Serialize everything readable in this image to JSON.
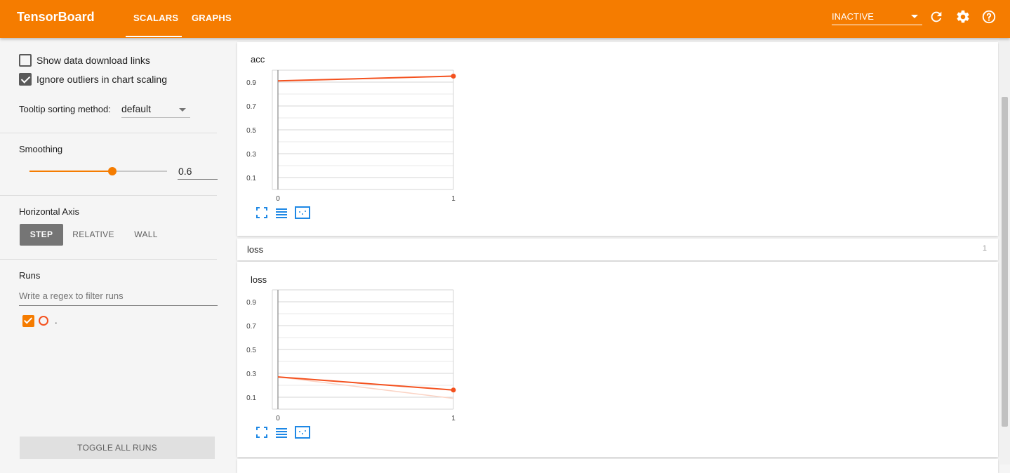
{
  "header": {
    "brand": "TensorBoard",
    "tabs": [
      {
        "label": "SCALARS",
        "active": true
      },
      {
        "label": "GRAPHS",
        "active": false
      }
    ],
    "status_select": "INACTIVE",
    "icons": [
      "reload-icon",
      "settings-icon",
      "help-icon"
    ],
    "accent_color": "#f57c00"
  },
  "sidebar": {
    "show_download_links": {
      "label": "Show data download links",
      "checked": false
    },
    "ignore_outliers": {
      "label": "Ignore outliers in chart scaling",
      "checked": true
    },
    "tooltip_sorting": {
      "label": "Tooltip sorting method:",
      "value": "default"
    },
    "smoothing": {
      "label": "Smoothing",
      "value": "0.6",
      "fraction": 0.6
    },
    "horizontal_axis": {
      "label": "Horizontal Axis",
      "options": [
        "STEP",
        "RELATIVE",
        "WALL"
      ],
      "selected": "STEP"
    },
    "runs": {
      "label": "Runs",
      "filter_placeholder": "Write a regex to filter runs",
      "items": [
        {
          "name": ".",
          "checked": true,
          "color": "#f4511e"
        }
      ]
    },
    "toggle_all_label": "TOGGLE ALL RUNS"
  },
  "main": {
    "acc_card": {
      "title": "acc"
    },
    "loss_group": {
      "label": "loss",
      "count": "1"
    },
    "loss_card": {
      "title": "loss"
    }
  },
  "chart_data": [
    {
      "type": "line",
      "title": "acc",
      "x_ticks": [
        "0",
        "1"
      ],
      "y_ticks": [
        "0.9",
        "0.7",
        "0.5",
        "0.3",
        "0.1"
      ],
      "xlim": [
        0,
        1
      ],
      "ylim": [
        0,
        1
      ],
      "series": [
        {
          "name": ".",
          "smoothed": true,
          "color": "#f4511e",
          "x": [
            0,
            1
          ],
          "y": [
            0.91,
            0.95
          ]
        }
      ],
      "grid": true
    },
    {
      "type": "line",
      "title": "loss",
      "x_ticks": [
        "0",
        "1"
      ],
      "y_ticks": [
        "0.9",
        "0.7",
        "0.5",
        "0.3",
        "0.1"
      ],
      "xlim": [
        0,
        1
      ],
      "ylim": [
        0,
        1
      ],
      "series": [
        {
          "name": ".",
          "smoothed": true,
          "color": "#f4511e",
          "x": [
            0,
            1
          ],
          "y": [
            0.27,
            0.16
          ]
        },
        {
          "name": ".",
          "smoothed": false,
          "color": "#fbd3c4",
          "x": [
            0,
            1
          ],
          "y": [
            0.27,
            0.09
          ]
        }
      ],
      "grid": true
    }
  ]
}
